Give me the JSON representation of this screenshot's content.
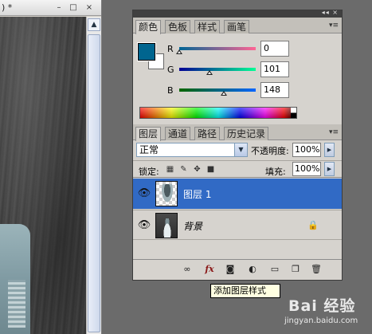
{
  "document": {
    "title": ") *",
    "minimize": "–",
    "maximize": "□",
    "close": "×"
  },
  "panel_header": {
    "controls": "◂◂ ×"
  },
  "color_panel": {
    "tabs": [
      "颜色",
      "色板",
      "样式",
      "画笔"
    ],
    "active_tab": "颜色",
    "menu_icon": "▾≡",
    "foreground_color": "#00658f",
    "background_color": "#ffffff",
    "channels": [
      {
        "label": "R",
        "value": "0"
      },
      {
        "label": "G",
        "value": "101"
      },
      {
        "label": "B",
        "value": "148"
      }
    ]
  },
  "layers_panel": {
    "tabs": [
      "图层",
      "通道",
      "路径",
      "历史记录"
    ],
    "active_tab": "图层",
    "menu_icon": "▾≡",
    "blend_mode": "正常",
    "opacity_label": "不透明度:",
    "opacity_value": "100%",
    "lock_label": "锁定:",
    "fill_label": "填充:",
    "fill_value": "100%",
    "layers": [
      {
        "name": "图层 1",
        "selected": true
      },
      {
        "name": "背景",
        "selected": false,
        "locked": true
      }
    ]
  },
  "tooltip": {
    "text": "添加图层样式"
  },
  "watermark": {
    "logo": "Bai  经验",
    "url": "jingyan.baidu.com"
  },
  "colors": {
    "selection": "#316ac5",
    "panel_bg": "#d6d3ce"
  }
}
